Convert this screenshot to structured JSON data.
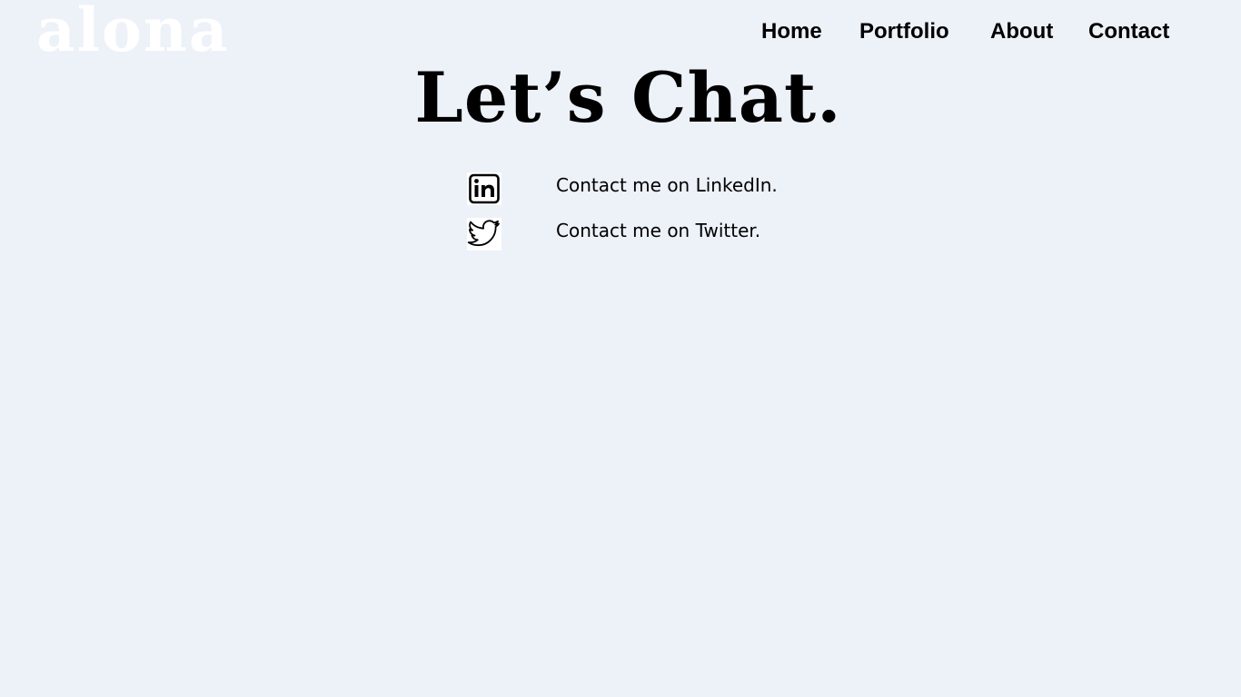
{
  "brand": {
    "logo_text": "alona",
    "logo_color": "#ffffff"
  },
  "nav": {
    "items": [
      {
        "label": "Home"
      },
      {
        "label": "Portfolio"
      },
      {
        "label": "About"
      },
      {
        "label": "Contact"
      }
    ]
  },
  "main": {
    "heading": "Let’s Chat.",
    "contacts": [
      {
        "icon": "linkedin-icon",
        "label": "Contact me on LinkedIn."
      },
      {
        "icon": "twitter-icon",
        "label": "Contact me on Twitter."
      }
    ]
  },
  "colors": {
    "background": "#edf1f8",
    "text": "#000000"
  }
}
